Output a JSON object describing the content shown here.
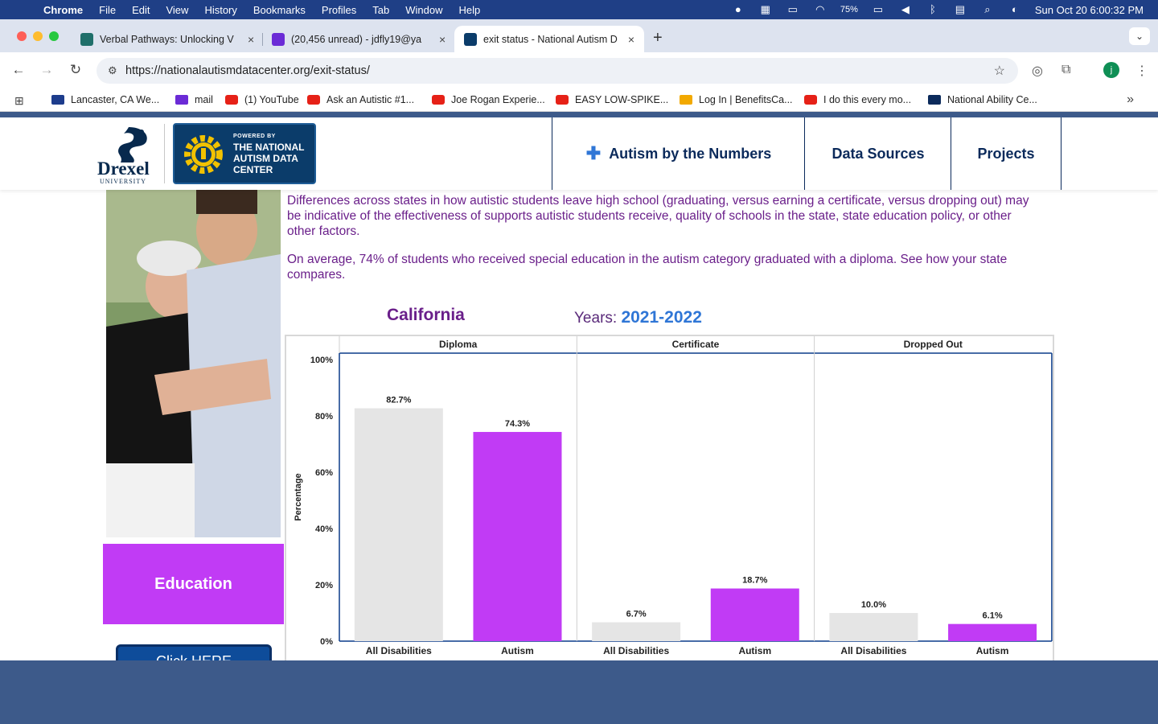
{
  "menubar": {
    "apple": "",
    "app": "Chrome",
    "items": [
      "File",
      "Edit",
      "View",
      "History",
      "Bookmarks",
      "Profiles",
      "Tab",
      "Window",
      "Help"
    ],
    "battery": "75%",
    "datetime": "Sun Oct 20  6:00:32 PM"
  },
  "tabs": [
    {
      "title": "Verbal Pathways: Unlocking V",
      "favicon_color": "#1f6f6a"
    },
    {
      "title": "(20,456 unread) - jdfly19@ya",
      "favicon_color": "#6b2bd6"
    },
    {
      "title": "exit status - National Autism D",
      "favicon_color": "#0b3c6a"
    }
  ],
  "toolbar": {
    "url": "https://nationalautismdatacenter.org/exit-status/",
    "profile_initial": "j"
  },
  "bookmarks": [
    {
      "label": "Lancaster, CA We...",
      "icon": "news-icon"
    },
    {
      "label": "mail",
      "icon": "mail-icon"
    },
    {
      "label": "(1) YouTube",
      "icon": "youtube-icon"
    },
    {
      "label": "Ask an Autistic #1...",
      "icon": "youtube-icon"
    },
    {
      "label": "Joe Rogan Experie...",
      "icon": "youtube-icon"
    },
    {
      "label": "EASY LOW-SPIKE...",
      "icon": "youtube-icon"
    },
    {
      "label": "Log In | BenefitsCa...",
      "icon": "benefits-icon"
    },
    {
      "label": "I do this every mo...",
      "icon": "youtube-icon"
    },
    {
      "label": "National Ability Ce...",
      "icon": "nac-icon"
    }
  ],
  "site": {
    "drexel_name": "Drexel",
    "drexel_university": "UNIVERSITY",
    "powered_by": "POWERED BY",
    "nadc_name": "THE NATIONAL AUTISM DATA CENTER",
    "nav": [
      "Autism by the Numbers",
      "Data Sources",
      "Projects"
    ]
  },
  "content": {
    "intro": "Differences across states in how autistic students leave high school (graduating, versus earning a certificate, versus dropping out) may be indicative of the effectiveness of supports autistic students receive, quality of schools in the state, state education policy, or other other factors.",
    "average": "On average, 74% of students who received special education in the autism category graduated with a diploma. See how your state compares.",
    "state": "California",
    "years_label": "Years: ",
    "years_value": "2021-2022",
    "education_label": "Education",
    "click_here": "Click HERE"
  },
  "colors": {
    "all_disabilities": "#e5e5e5",
    "autism": "#c13bf5",
    "header_text": "#0b2a5b",
    "body_text": "#6a1f8a"
  },
  "chart_data": {
    "type": "bar",
    "panels": [
      "Diploma",
      "Certificate",
      "Dropped Out"
    ],
    "categories": [
      "All Disabilities",
      "Autism"
    ],
    "series": [
      {
        "name": "All Disabilities",
        "values": [
          82.7,
          6.7,
          10.0
        ]
      },
      {
        "name": "Autism",
        "values": [
          74.3,
          18.7,
          6.1
        ]
      }
    ],
    "value_labels": [
      [
        "82.7%",
        "74.3%"
      ],
      [
        "6.7%",
        "18.7%"
      ],
      [
        "10.0%",
        "6.1%"
      ]
    ],
    "ylabel": "Percentage",
    "ylim": [
      0,
      100
    ],
    "yticks": [
      "0%",
      "20%",
      "40%",
      "60%",
      "80%",
      "100%"
    ]
  }
}
